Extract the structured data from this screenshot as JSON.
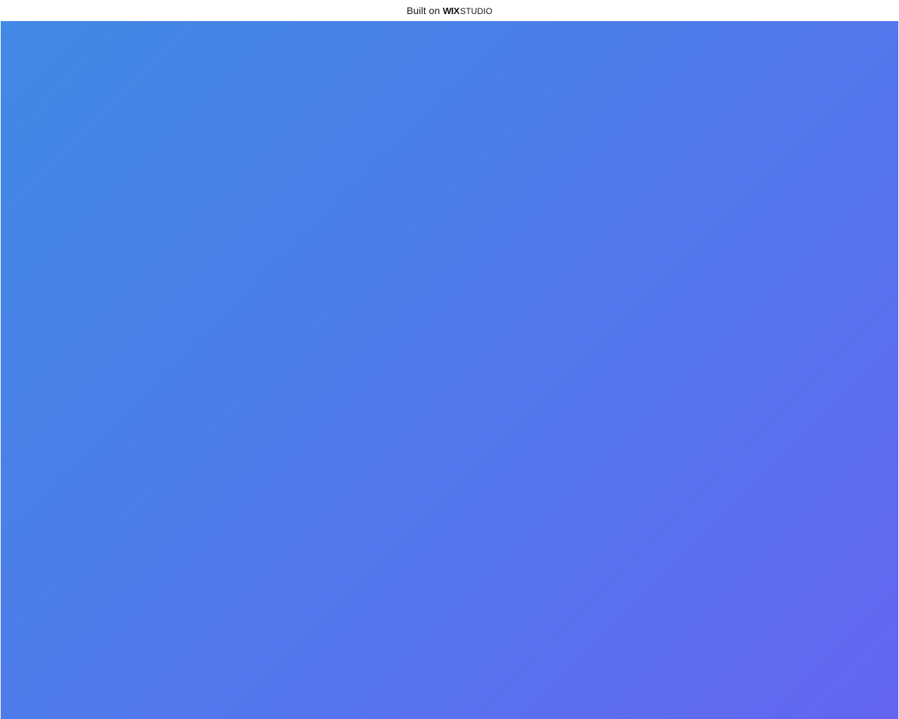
{
  "banner": {
    "built_on_label": "Built on",
    "wix_label": "WIX",
    "studio_label": "STUDIO"
  },
  "colors": {
    "gradient_start": "#4189e4",
    "gradient_end": "#6465f0",
    "banner_background": "#ffffff"
  }
}
